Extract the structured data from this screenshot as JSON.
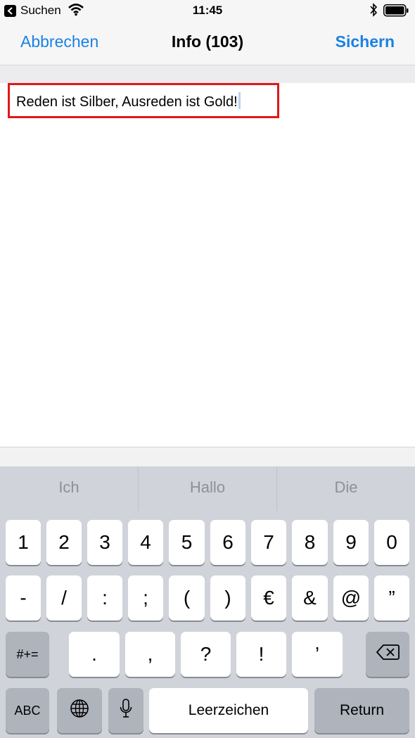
{
  "status_bar": {
    "back_app": "Suchen",
    "time": "11:45"
  },
  "nav": {
    "cancel": "Abbrechen",
    "title": "Info (103)",
    "save": "Sichern"
  },
  "note": {
    "text": "Reden ist Silber, Ausreden ist Gold!"
  },
  "keyboard": {
    "suggestions": [
      "Ich",
      "Hallo",
      "Die"
    ],
    "row1": [
      "1",
      "2",
      "3",
      "4",
      "5",
      "6",
      "7",
      "8",
      "9",
      "0"
    ],
    "row2": [
      "-",
      "/",
      ":",
      ";",
      "(",
      ")",
      "€",
      "&",
      "@",
      "”"
    ],
    "row3_left": "#+=",
    "row3": [
      ".",
      ",",
      "?",
      "!",
      "’"
    ],
    "abc": "ABC",
    "space": "Leerzeichen",
    "return": "Return"
  },
  "colors": {
    "accent": "#1a82e2",
    "highlight": "#e01818"
  }
}
